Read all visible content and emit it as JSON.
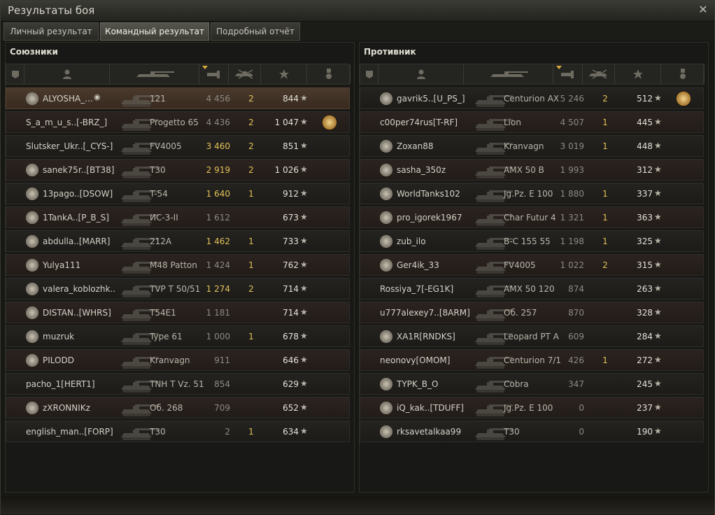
{
  "window": {
    "title": "Результаты боя"
  },
  "tabs": [
    "Личный результат",
    "Командный результат",
    "Подробный отчёт"
  ],
  "allies": {
    "title": "Союзники",
    "rows": [
      {
        "name": "ALYOSHA_...",
        "tank": "121",
        "damage": "4 456",
        "kills": "2",
        "xp": "844",
        "badge": true,
        "medal": false,
        "you": true,
        "dim": true
      },
      {
        "name": "S_a_m_u_s..[-BRZ_]",
        "tank": "Progetto 65",
        "damage": "4 436",
        "kills": "2",
        "xp": "1 047",
        "badge": false,
        "medal": true,
        "dim": true
      },
      {
        "name": "Slutsker_Ukr..[_CYS-]",
        "tank": "FV4005",
        "damage": "3 460",
        "kills": "2",
        "xp": "851",
        "badge": false,
        "medal": false
      },
      {
        "name": "sanek75r..[BT38]",
        "tank": "T30",
        "damage": "2 919",
        "kills": "2",
        "xp": "1 026",
        "badge": true,
        "medal": false
      },
      {
        "name": "13pago..[DSOW]",
        "tank": "T-54",
        "damage": "1 640",
        "kills": "1",
        "xp": "912",
        "badge": true,
        "medal": false
      },
      {
        "name": "1TankA..[P_B_S]",
        "tank": "ИС-3-II",
        "damage": "1 612",
        "kills": "",
        "xp": "673",
        "badge": true,
        "medal": false,
        "dim": true
      },
      {
        "name": "abdulla..[MARR]",
        "tank": "212A",
        "damage": "1 462",
        "kills": "1",
        "xp": "733",
        "badge": true,
        "medal": false
      },
      {
        "name": "Yulya111",
        "tank": "M48 Patton",
        "damage": "1 424",
        "kills": "1",
        "xp": "762",
        "badge": true,
        "medal": false,
        "dim": true
      },
      {
        "name": "valera_koblozhk..",
        "tank": "TVP T 50/51",
        "damage": "1 274",
        "kills": "2",
        "xp": "714",
        "badge": true,
        "medal": false
      },
      {
        "name": "DISTAN..[WHRS]",
        "tank": "T54E1",
        "damage": "1 181",
        "kills": "",
        "xp": "714",
        "badge": true,
        "medal": false,
        "dim": true
      },
      {
        "name": "muzruk",
        "tank": "Type 61",
        "damage": "1 000",
        "kills": "1",
        "xp": "678",
        "badge": true,
        "medal": false,
        "dim": true
      },
      {
        "name": "PILODD",
        "tank": "Kranvagn",
        "damage": "911",
        "kills": "",
        "xp": "646",
        "badge": true,
        "medal": false,
        "dim": true
      },
      {
        "name": "pacho_1[HERT1]",
        "tank": "TNH T Vz. 51",
        "damage": "854",
        "kills": "",
        "xp": "629",
        "badge": false,
        "medal": false,
        "dim": true
      },
      {
        "name": "zXRONNIKz",
        "tank": "Об. 268",
        "damage": "709",
        "kills": "",
        "xp": "652",
        "badge": true,
        "medal": false,
        "dim": true
      },
      {
        "name": "english_man..[FORP]",
        "tank": "T30",
        "damage": "2",
        "kills": "1",
        "xp": "634",
        "badge": false,
        "medal": false,
        "dim": true
      }
    ]
  },
  "enemies": {
    "title": "Противник",
    "rows": [
      {
        "name": "gavrik5..[U_PS_]",
        "tank": "Centurion AX",
        "damage": "5 246",
        "kills": "2",
        "xp": "512",
        "badge": true,
        "medal": true,
        "dim": true
      },
      {
        "name": "c00per74rus[T-RF]",
        "tank": "Lion",
        "damage": "4 507",
        "kills": "1",
        "xp": "445",
        "badge": false,
        "medal": false,
        "dim": true
      },
      {
        "name": "Zoxan88",
        "tank": "Kranvagn",
        "damage": "3 019",
        "kills": "1",
        "xp": "448",
        "badge": true,
        "medal": false,
        "dim": true
      },
      {
        "name": "sasha_350z",
        "tank": "AMX 50 B",
        "damage": "1 993",
        "kills": "",
        "xp": "312",
        "badge": true,
        "medal": false,
        "dim": true
      },
      {
        "name": "WorldTanks102",
        "tank": "Jg.Pz. E 100",
        "damage": "1 880",
        "kills": "1",
        "xp": "337",
        "badge": true,
        "medal": false,
        "dim": true
      },
      {
        "name": "pro_igorek1967",
        "tank": "Char Futur 4",
        "damage": "1 321",
        "kills": "1",
        "xp": "363",
        "badge": true,
        "medal": false,
        "dim": true
      },
      {
        "name": "zub_ilo",
        "tank": "B-C 155 55",
        "damage": "1 198",
        "kills": "1",
        "xp": "325",
        "badge": true,
        "medal": false,
        "dim": true
      },
      {
        "name": "Ger4ik_33",
        "tank": "FV4005",
        "damage": "1 022",
        "kills": "2",
        "xp": "315",
        "badge": true,
        "medal": false,
        "dim": true
      },
      {
        "name": "Rossiya_7[-EG1K]",
        "tank": "AMX 50 120",
        "damage": "874",
        "kills": "",
        "xp": "263",
        "badge": false,
        "medal": false,
        "dim": true
      },
      {
        "name": "u777alexey7..[8ARM]",
        "tank": "Об. 257",
        "damage": "870",
        "kills": "",
        "xp": "328",
        "badge": false,
        "medal": false,
        "dim": true
      },
      {
        "name": "XA1R[RNDKS]",
        "tank": "Leopard PT A",
        "damage": "609",
        "kills": "",
        "xp": "284",
        "badge": true,
        "medal": false,
        "dim": true
      },
      {
        "name": "neonovy[OMOM]",
        "tank": "Centurion 7/1",
        "damage": "426",
        "kills": "1",
        "xp": "272",
        "badge": false,
        "medal": false,
        "dim": true
      },
      {
        "name": "TYPK_B_O",
        "tank": "Cobra",
        "damage": "347",
        "kills": "",
        "xp": "245",
        "badge": true,
        "medal": false,
        "dim": true
      },
      {
        "name": "iQ_kak..[TDUFF]",
        "tank": "Jg.Pz. E 100",
        "damage": "0",
        "kills": "",
        "xp": "237",
        "badge": true,
        "medal": false,
        "dim": true
      },
      {
        "name": "rksavetalkaa99",
        "tank": "T30",
        "damage": "0",
        "kills": "",
        "xp": "190",
        "badge": true,
        "medal": false,
        "dim": true
      }
    ]
  }
}
